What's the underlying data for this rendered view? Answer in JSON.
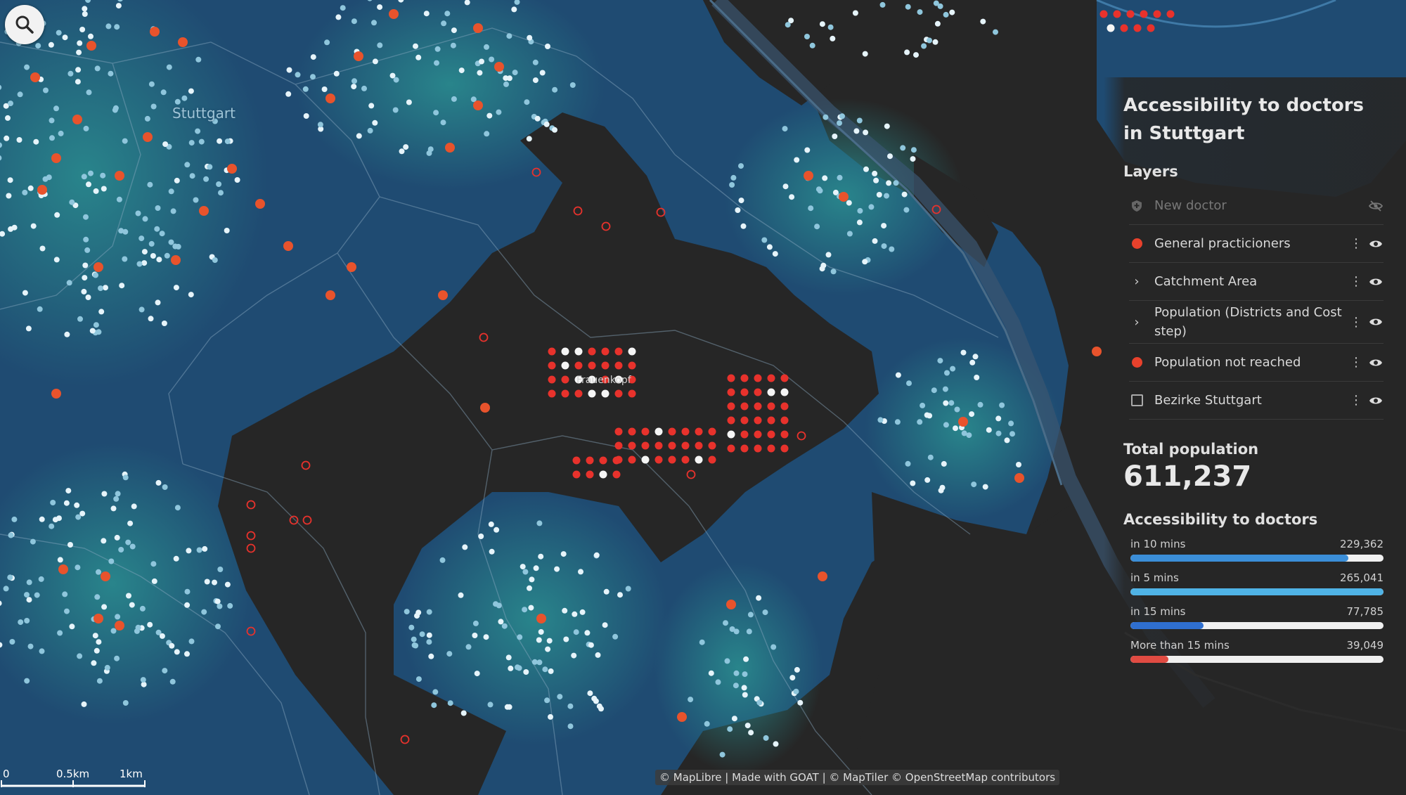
{
  "map": {
    "city_label": "Stuttgart",
    "place_label": "Frauenkopf",
    "search_icon": "search-icon",
    "attribution": "© MapLibre | Made with GOAT | © MapTiler © OpenStreetMap contributors",
    "scale": {
      "zero": "0",
      "half": "0.5km",
      "one": "1km"
    }
  },
  "panel": {
    "title_line1": "Accessibility to doctors",
    "title_line2": "in Stuttgart",
    "layers_heading": "Layers",
    "layers": [
      {
        "label": "New doctor",
        "icon": "plus-shield-icon",
        "visibility": "eye-off-icon",
        "disabled": true
      },
      {
        "label": "General practicioners",
        "icon": "red-dot-icon",
        "visibility": "eye-icon"
      },
      {
        "label": "Catchment Area",
        "icon": "chevron-right-icon",
        "visibility": "eye-icon"
      },
      {
        "label": "Population (Districts and Cost step)",
        "icon": "chevron-right-icon",
        "visibility": "eye-icon"
      },
      {
        "label": "Population not reached",
        "icon": "red-dot-icon",
        "visibility": "eye-icon"
      },
      {
        "label": "Bezirke Stuttgart",
        "icon": "checkbox-icon",
        "visibility": "eye-icon"
      }
    ],
    "total_heading": "Total population",
    "total_value": "611,237",
    "accessibility_heading": "Accessibility to doctors",
    "accessibility": [
      {
        "label": "in 10 mins",
        "value": "229,362",
        "fraction": 0.86,
        "color": "#3b8ed8"
      },
      {
        "label": "in 5 mins",
        "value": "265,041",
        "fraction": 1.0,
        "color": "#4fb3e6"
      },
      {
        "label": "in 15 mins",
        "value": "77,785",
        "fraction": 0.29,
        "color": "#2f6fd0"
      },
      {
        "label": "More than 15 mins",
        "value": "39,049",
        "fraction": 0.15,
        "color": "#e04b42"
      }
    ]
  },
  "colors": {
    "background_dark": "#262626",
    "catchment_blue": "#1f4b72",
    "catchment_teal": "#1f6a78",
    "doctor_red": "#e8412c",
    "population_dot": "#d8eef6"
  }
}
